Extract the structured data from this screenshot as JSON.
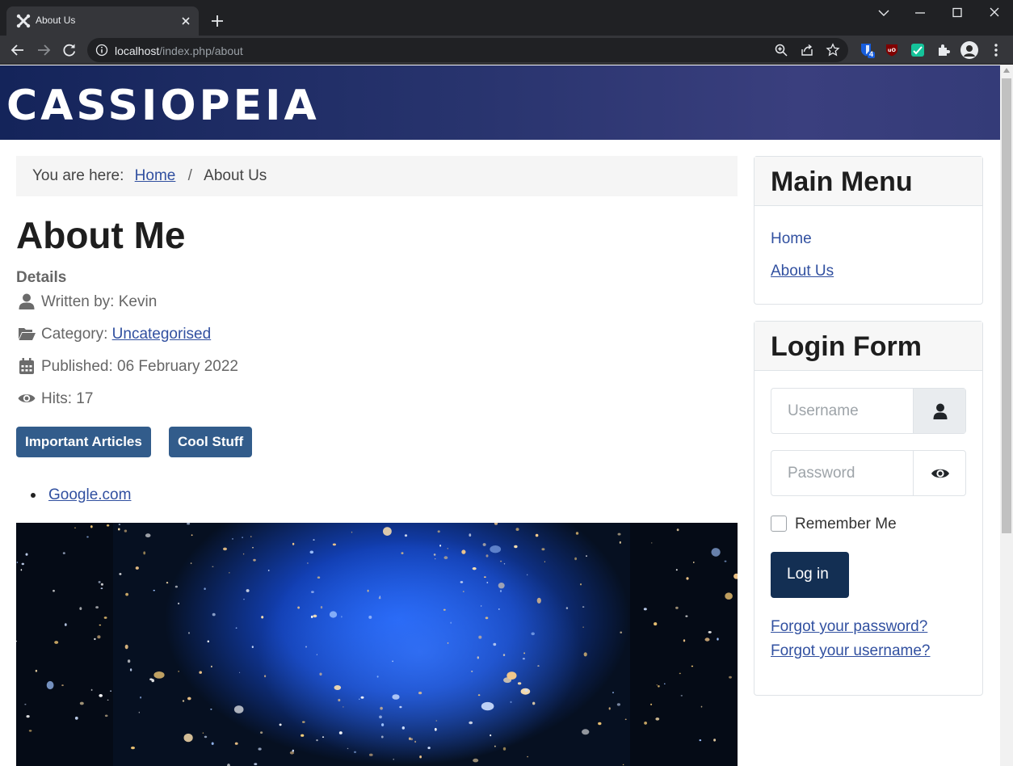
{
  "browser": {
    "tab_title": "About Us",
    "url_host": "localhost",
    "url_path": "/index.php/about",
    "extension_badge": "4"
  },
  "site": {
    "brand": "CASSIOPEIA"
  },
  "breadcrumb": {
    "prefix": "You are here:",
    "home": "Home",
    "separator": "/",
    "current": "About Us"
  },
  "article": {
    "title": "About Me",
    "details_heading": "Details",
    "written_by": "Written by: Kevin",
    "category_prefix": "Category:",
    "category": "Uncategorised",
    "published": "Published: 06 February 2022",
    "hits": "Hits: 17",
    "tags": [
      "Important Articles",
      "Cool Stuff"
    ],
    "links": [
      "Google.com"
    ]
  },
  "main_menu": {
    "title": "Main Menu",
    "items": [
      "Home",
      "About Us"
    ]
  },
  "login": {
    "title": "Login Form",
    "username_placeholder": "Username",
    "password_placeholder": "Password",
    "remember_label": "Remember Me",
    "submit_label": "Log in",
    "forgot_password": "Forgot your password?",
    "forgot_username": "Forgot your username?"
  },
  "colors": {
    "chrome_dark": "#202124",
    "chrome_toolbar": "#35363a",
    "header_gradient_start": "#14245a",
    "header_gradient_end": "#3a3f7e",
    "link": "#3150a0",
    "tag_button": "#325c8b",
    "login_button": "#132f53"
  }
}
